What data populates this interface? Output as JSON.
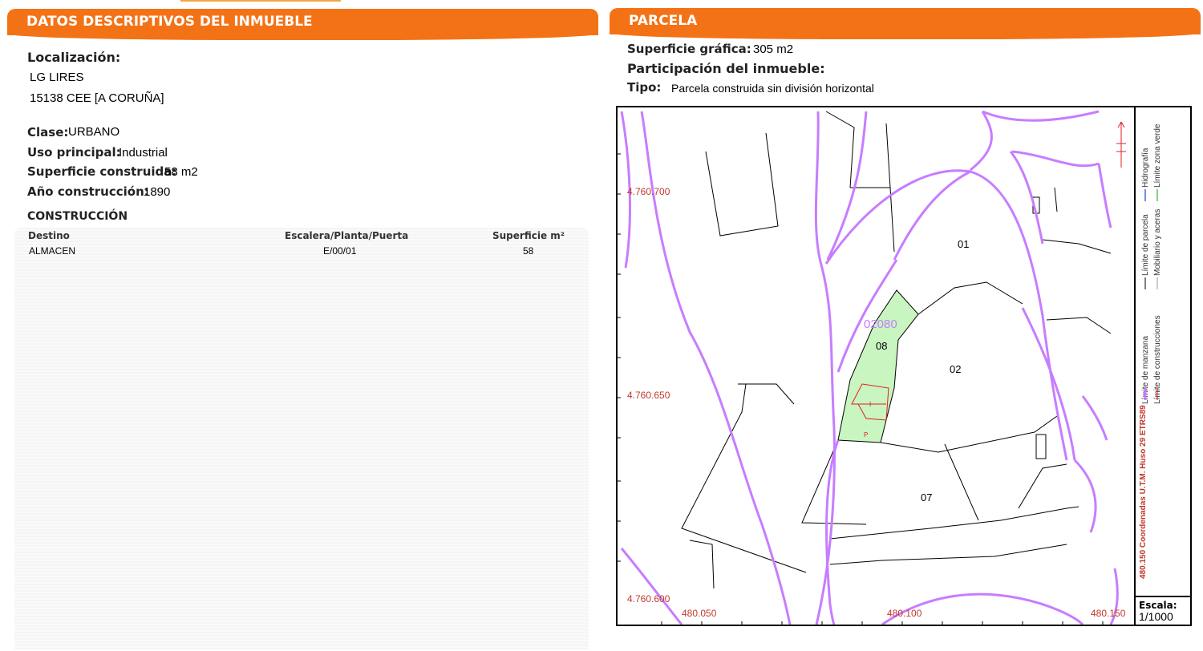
{
  "left": {
    "header": "DATOS DESCRIPTIVOS DEL INMUEBLE",
    "localizacion_label": "Localización:",
    "address_line1": "LG LIRES",
    "address_line2": "15138 CEE [A CORUÑA]",
    "clase_label": "Clase:",
    "clase_value": "URBANO",
    "uso_label": "Uso principal:",
    "uso_value": "Industrial",
    "superficie_label": "Superficie construida:",
    "superficie_value": "58 m2",
    "anio_label": "Año construcción:",
    "anio_value": "1890",
    "construccion_title": "CONSTRUCCIÓN",
    "table": {
      "columns": [
        "Destino",
        "Escalera/Planta/Puerta",
        "Superficie m²"
      ],
      "rows": [
        [
          "ALMACEN",
          "E/00/01",
          "58"
        ]
      ]
    }
  },
  "right": {
    "header": "PARCELA",
    "superficie_label": "Superficie gráfica:",
    "superficie_value": "305 m2",
    "participacion_label": "Participación del inmueble:",
    "tipo_label": "Tipo:",
    "tipo_value": "Parcela construida sin división horizontal",
    "map": {
      "parcel_labels": [
        "01",
        "02",
        "07",
        "08"
      ],
      "block_label": "02080",
      "build_labels": [
        "I",
        "P"
      ],
      "coords_y": [
        "4.760.700",
        "4.760.650",
        "4.760.600"
      ],
      "coords_x": [
        "480.050",
        "480.100",
        "480.150"
      ],
      "legend": {
        "manzana": "Límite de manzana",
        "construcciones": "Límite de construcciones",
        "parcela": "Límite de parcela",
        "mobiliario": "Mobiliario y aceras",
        "hidrografia": "Hidrografía",
        "zona_verde": "Límite zona verde",
        "coords_note": "480.150 Coordenadas U.T.M. Huso 29 ETRS89"
      },
      "scale_label": "Escala:",
      "scale_value": "1/1000",
      "colors": {
        "manzana": "#c77dff",
        "construcciones": "#e02020",
        "parcela": "#000000",
        "hidrografia": "#6f8fe0",
        "zona_verde": "#7fd07f",
        "highlight": "#c8f5c0"
      }
    }
  }
}
